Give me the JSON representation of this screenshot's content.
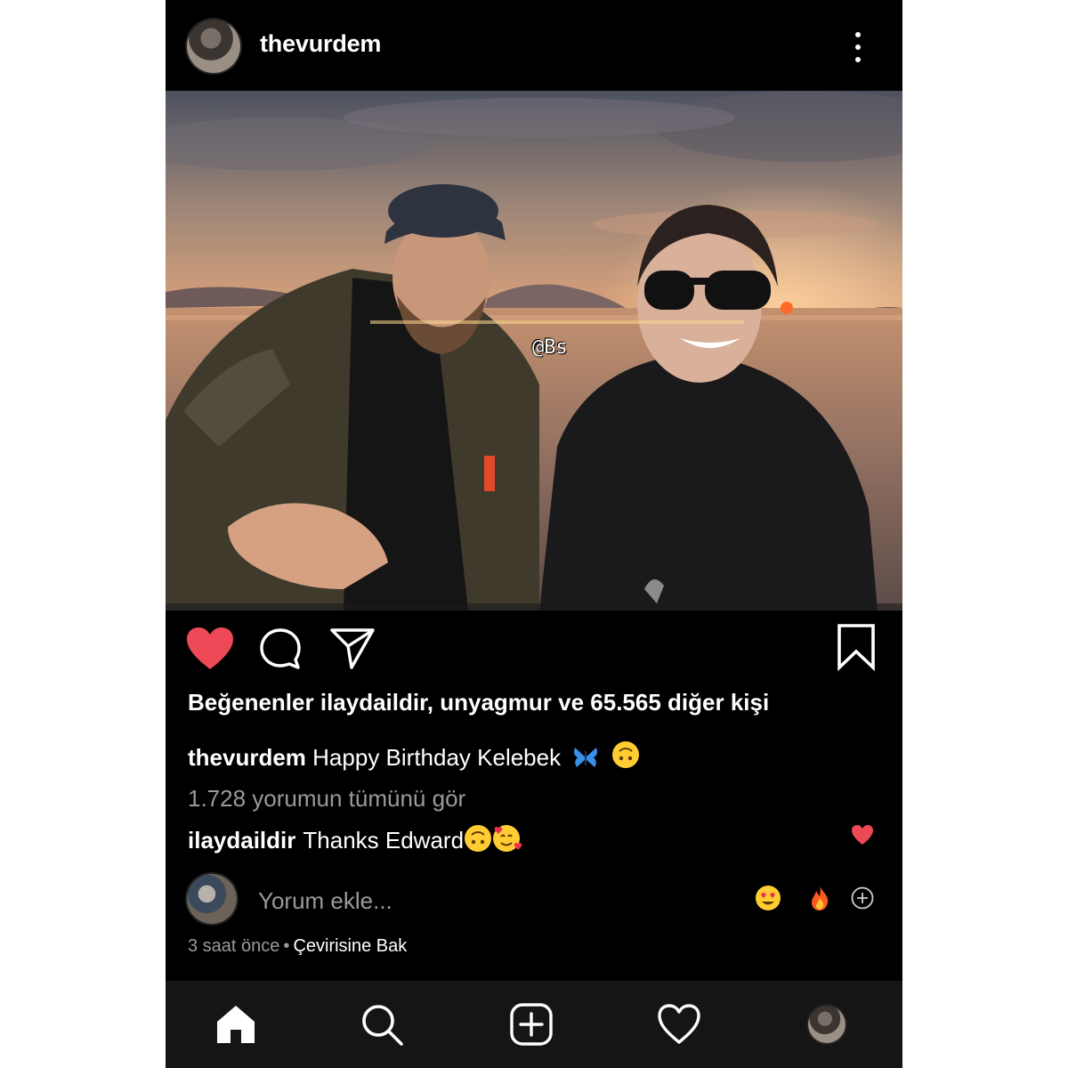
{
  "post": {
    "username": "thevurdem",
    "watermark": "@Bs"
  },
  "likes": {
    "prefix": "Beğenenler",
    "text": "ilaydaildir, unyagmur ve 65.565 diğer kişi"
  },
  "caption": {
    "username": "thevurdem",
    "text": "Happy Birthday Kelebek",
    "emojis": [
      "butterfly",
      "upside-down-face"
    ]
  },
  "comments": {
    "view_all": "1.728 yorumun tümünü gör",
    "items": [
      {
        "username": "ilaydaildir",
        "text": "Thanks Edward",
        "emojis": [
          "upside-down-face",
          "smiling-face-with-hearts"
        ]
      }
    ]
  },
  "composer": {
    "placeholder": "Yorum ekle...",
    "quick_emojis": [
      "heart-eyes",
      "fire"
    ]
  },
  "meta": {
    "time": "3 saat önce",
    "separator": "•",
    "translate": "Çevirisine Bak"
  },
  "colors": {
    "background": "#000000",
    "like_red": "#ed4956",
    "muted_text": "#9a9a9a",
    "nav_bg": "#151515"
  },
  "icons": {
    "header": [
      "more-vertical-icon"
    ],
    "actions": [
      "heart-filled-icon",
      "comment-icon",
      "share-icon",
      "bookmark-icon"
    ],
    "nav": [
      "home-icon",
      "search-icon",
      "add-post-icon",
      "activity-heart-icon",
      "profile-avatar"
    ]
  }
}
